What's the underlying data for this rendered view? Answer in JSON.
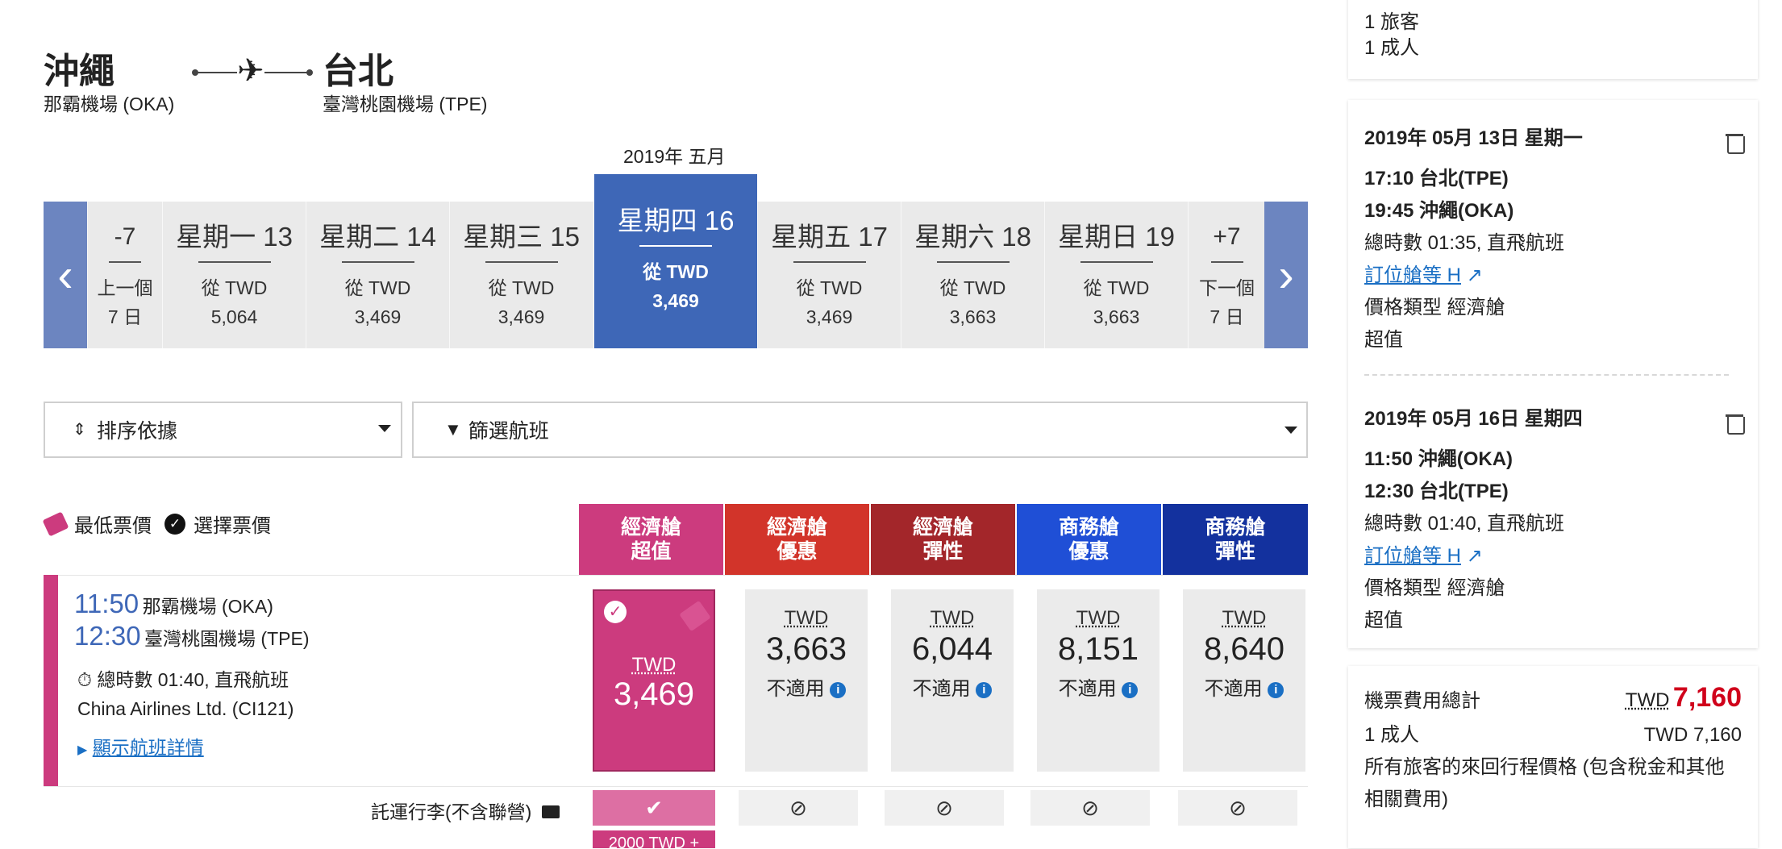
{
  "route": {
    "origin_city": "沖繩",
    "origin_airport": "那霸機場 (OKA)",
    "dest_city": "台北",
    "dest_airport": "臺灣桃園機場 (TPE)"
  },
  "calendar": {
    "month": "2019年 五月",
    "prev": {
      "top": "-7",
      "label1": "上一個",
      "label2": "7 日"
    },
    "next": {
      "top": "+7",
      "label1": "下一個",
      "label2": "7 日"
    },
    "days": [
      {
        "name": "星期一 13",
        "from": "從 TWD",
        "price": "5,064"
      },
      {
        "name": "星期二 14",
        "from": "從 TWD",
        "price": "3,469"
      },
      {
        "name": "星期三 15",
        "from": "從 TWD",
        "price": "3,469"
      },
      {
        "name": "星期四 16",
        "from": "從 TWD",
        "price": "3,469",
        "selected": true
      },
      {
        "name": "星期五 17",
        "from": "從 TWD",
        "price": "3,469"
      },
      {
        "name": "星期六 18",
        "from": "從 TWD",
        "price": "3,663"
      },
      {
        "name": "星期日 19",
        "from": "從 TWD",
        "price": "3,663"
      }
    ]
  },
  "controls": {
    "sort_label": "排序依據",
    "filter_label": "篩選航班"
  },
  "legend": {
    "lowest": "最低票價",
    "selected": "選擇票價"
  },
  "fare_columns": [
    {
      "line1": "經濟艙",
      "line2": "超值",
      "color": "#cc3b7e"
    },
    {
      "line1": "經濟艙",
      "line2": "優惠",
      "color": "#d2342a"
    },
    {
      "line1": "經濟艙",
      "line2": "彈性",
      "color": "#a3262a"
    },
    {
      "line1": "商務艙",
      "line2": "優惠",
      "color": "#1f4fd6"
    },
    {
      "line1": "商務艙",
      "line2": "彈性",
      "color": "#13319e"
    }
  ],
  "flight": {
    "dep_time": "11:50",
    "dep_airport": "那霸機場 (OKA)",
    "arr_time": "12:30",
    "arr_airport": "臺灣桃園機場 (TPE)",
    "duration": "總時數 01:40, 直飛航班",
    "carrier": "China Airlines Ltd. (CI121)",
    "details_link": "顯示航班詳情",
    "selected_fare": {
      "currency": "TWD",
      "amount": "3,469"
    },
    "fares": [
      {
        "currency": "TWD",
        "amount": "3,663",
        "status": "不適用"
      },
      {
        "currency": "TWD",
        "amount": "6,044",
        "status": "不適用"
      },
      {
        "currency": "TWD",
        "amount": "8,151",
        "status": "不適用"
      },
      {
        "currency": "TWD",
        "amount": "8,640",
        "status": "不適用"
      }
    ]
  },
  "baggage": {
    "label": "託運行李(不含聯營)",
    "selected_mark": "✔",
    "na_mark": "⊘",
    "selected_extra": "2000 TWD +"
  },
  "summary": {
    "travelers": "1 旅客",
    "adults": "1 成人",
    "segments": [
      {
        "date": "2019年 05月 13日 星期一",
        "dep": "17:10 台北(TPE)",
        "arr": "19:45 沖繩(OKA)",
        "duration": "總時數 01:35, 直飛航班",
        "booking_class": "訂位艙等 H",
        "fare_type": "價格類型 經濟艙",
        "fare_name": "超值"
      },
      {
        "date": "2019年 05月 16日 星期四",
        "dep": "11:50 沖繩(OKA)",
        "arr": "12:30 台北(TPE)",
        "duration": "總時數 01:40, 直飛航班",
        "booking_class": "訂位艙等 H",
        "fare_type": "價格類型 經濟艙",
        "fare_name": "超值"
      }
    ],
    "total_label": "機票費用總計",
    "total_currency": "TWD",
    "total_amount": "7,160",
    "adult_line": "1 成人",
    "adult_amount": "TWD 7,160",
    "note": "所有旅客的來回行程價格 (包含稅金和其他相關費用)",
    "accent_color": "#d0021b"
  }
}
